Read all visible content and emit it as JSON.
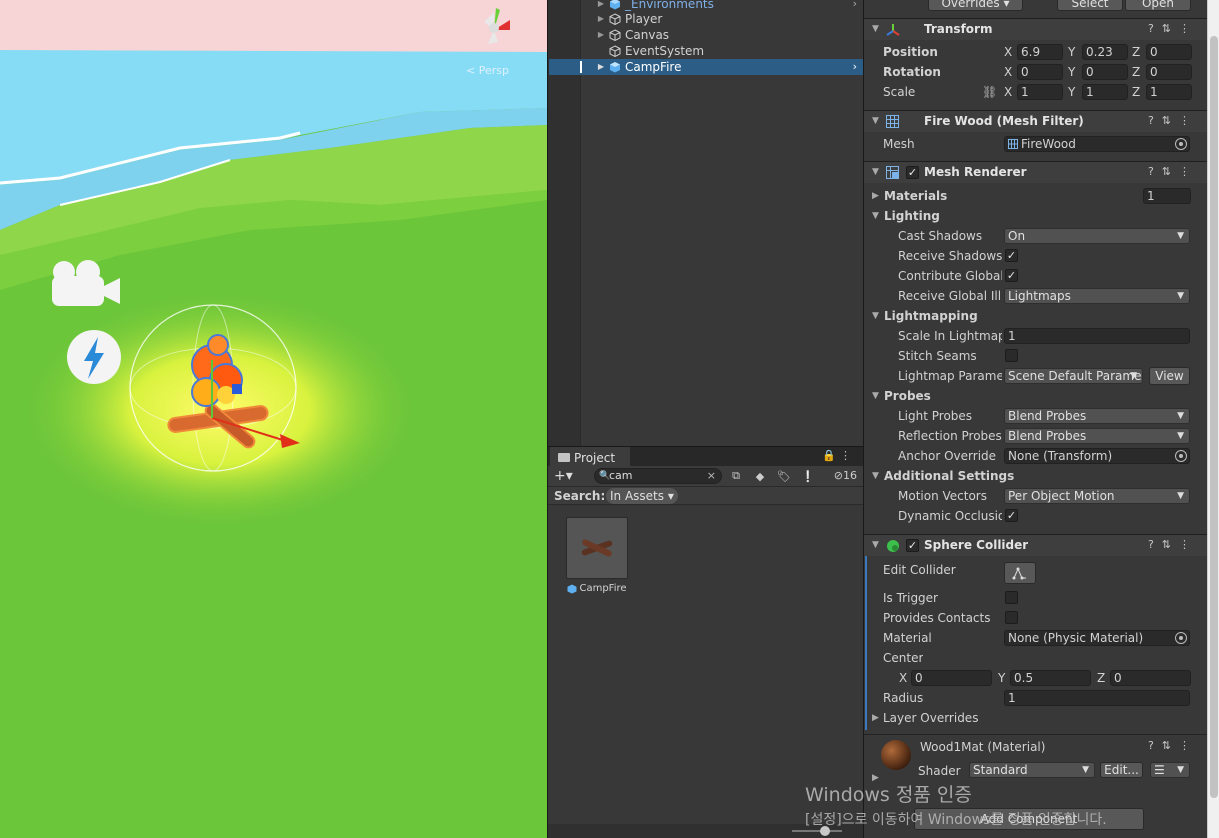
{
  "scene": {
    "persp_label": "< Persp"
  },
  "hierarchy": {
    "items": [
      {
        "label": "_Environments",
        "color": "#7fb0e8"
      },
      {
        "label": "Player"
      },
      {
        "label": "Canvas"
      },
      {
        "label": "EventSystem"
      },
      {
        "label": "CampFire",
        "selected": true
      }
    ]
  },
  "project": {
    "tab": "Project",
    "search_value": "cam",
    "search_label": "Search:",
    "search_scope": "In Assets",
    "hidden_count": "16",
    "asset_name": "CampFire"
  },
  "inspector": {
    "top_buttons": {
      "overrides": "Overrides",
      "select": "Select",
      "open": "Open"
    },
    "transform": {
      "title": "Transform",
      "position_label": "Position",
      "rotation_label": "Rotation",
      "scale_label": "Scale",
      "position": {
        "x": "6.9",
        "y": "0.23",
        "z": "0"
      },
      "rotation": {
        "x": "0",
        "y": "0",
        "z": "0"
      },
      "scale": {
        "x": "1",
        "y": "1",
        "z": "1"
      },
      "axis": {
        "x": "X",
        "y": "Y",
        "z": "Z"
      }
    },
    "mesh_filter": {
      "title": "Fire Wood (Mesh Filter)",
      "mesh_label": "Mesh",
      "mesh_value": "FireWood"
    },
    "mesh_renderer": {
      "title": "Mesh Renderer",
      "materials_label": "Materials",
      "materials_count": "1",
      "lighting_label": "Lighting",
      "cast_shadows_label": "Cast Shadows",
      "cast_shadows_value": "On",
      "receive_shadows_label": "Receive Shadows",
      "contribute_gi_label": "Contribute Global I",
      "receive_gi_label": "Receive Global Illu",
      "receive_gi_value": "Lightmaps",
      "lightmapping_label": "Lightmapping",
      "scale_lightmap_label": "Scale In Lightmap",
      "scale_lightmap_value": "1",
      "stitch_seams_label": "Stitch Seams",
      "lightmap_params_label": "Lightmap Paramete",
      "lightmap_params_value": "Scene Default Parame",
      "view_button": "View",
      "probes_label": "Probes",
      "light_probes_label": "Light Probes",
      "light_probes_value": "Blend Probes",
      "reflection_probes_label": "Reflection Probes",
      "reflection_probes_value": "Blend Probes",
      "anchor_override_label": "Anchor Override",
      "anchor_override_value": "None (Transform)",
      "additional_label": "Additional Settings",
      "motion_vectors_label": "Motion Vectors",
      "motion_vectors_value": "Per Object Motion",
      "dynamic_occlusion_label": "Dynamic Occlusior"
    },
    "sphere_collider": {
      "title": "Sphere Collider",
      "edit_collider_label": "Edit Collider",
      "is_trigger_label": "Is Trigger",
      "provides_contacts_label": "Provides Contacts",
      "material_label": "Material",
      "material_value": "None (Physic Material)",
      "center_label": "Center",
      "center": {
        "x": "0",
        "y": "0.5",
        "z": "0"
      },
      "radius_label": "Radius",
      "radius_value": "1",
      "layer_overrides_label": "Layer Overrides"
    },
    "material": {
      "title": "Wood1Mat (Material)",
      "shader_label": "Shader",
      "shader_value": "Standard",
      "edit_button": "Edit..."
    },
    "add_component": "Add Component"
  },
  "watermark": {
    "line1": "Windows 정품 인증",
    "line2": "[설정]으로 이동하여 Windows를 정품 인증합니다."
  },
  "colors": {
    "selection": "#2c5d87",
    "accent_blue": "#3a79bb",
    "grass": "#6cc63a",
    "water": "#7fd6f0"
  }
}
